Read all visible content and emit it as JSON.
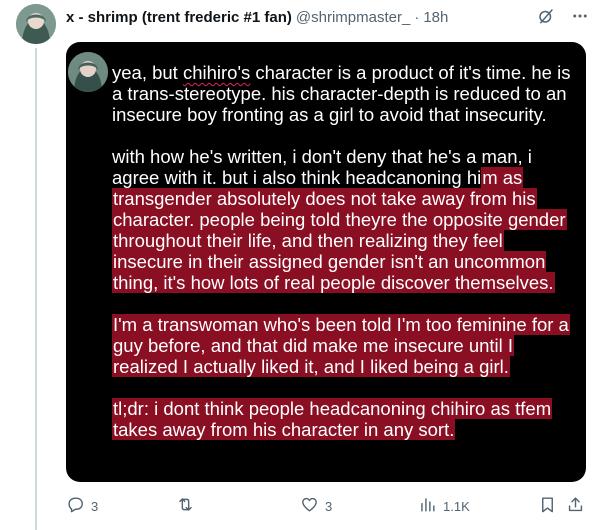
{
  "tweet": {
    "display_name": "x - shrimp (trent frederic #1 fan)",
    "handle": "@shrimpmaster_",
    "separator": "·",
    "time": "18h"
  },
  "image_text": {
    "p1_a": "yea, but ",
    "p1_chihiro": "chihiro's",
    "p1_b": " character is a product of it's time. he is a trans-stereotype. his character-depth is reduced to an insecure boy fronting as a girl to avoid that insecurity.",
    "p2_plain": "with how he's written, i don't deny that he's a man, i agree with it. but i also think headcanoning hi",
    "p2_hl": "m as transgender absolutely does not take away from his character. people being told theyre the opposite gender throughout their life, and then realizing they feel insecure in their assigned gender isn't an uncommon thing, it's how lots of real people discover themselves.",
    "p3": "I'm a transwoman who's been told I'm too feminine for a guy before, and that did make me insecure until I realized I actually liked it, and I liked being a girl.",
    "p4": "tl;dr: i dont think people headcanoning chihiro as tfem takes away from his character in any sort."
  },
  "footer": {
    "replies": "3",
    "reposts": "",
    "likes": "3",
    "views": "1.1K"
  },
  "icons": {
    "reply": "reply-icon",
    "repost": "repost-icon",
    "like": "heart-icon",
    "views": "views-icon",
    "bookmark": "bookmark-icon",
    "share": "share-icon",
    "grok": "grok-icon",
    "more": "more-icon"
  },
  "colors": {
    "highlight": "#8a0f23",
    "media_bg": "#000000",
    "muted": "#536471"
  }
}
